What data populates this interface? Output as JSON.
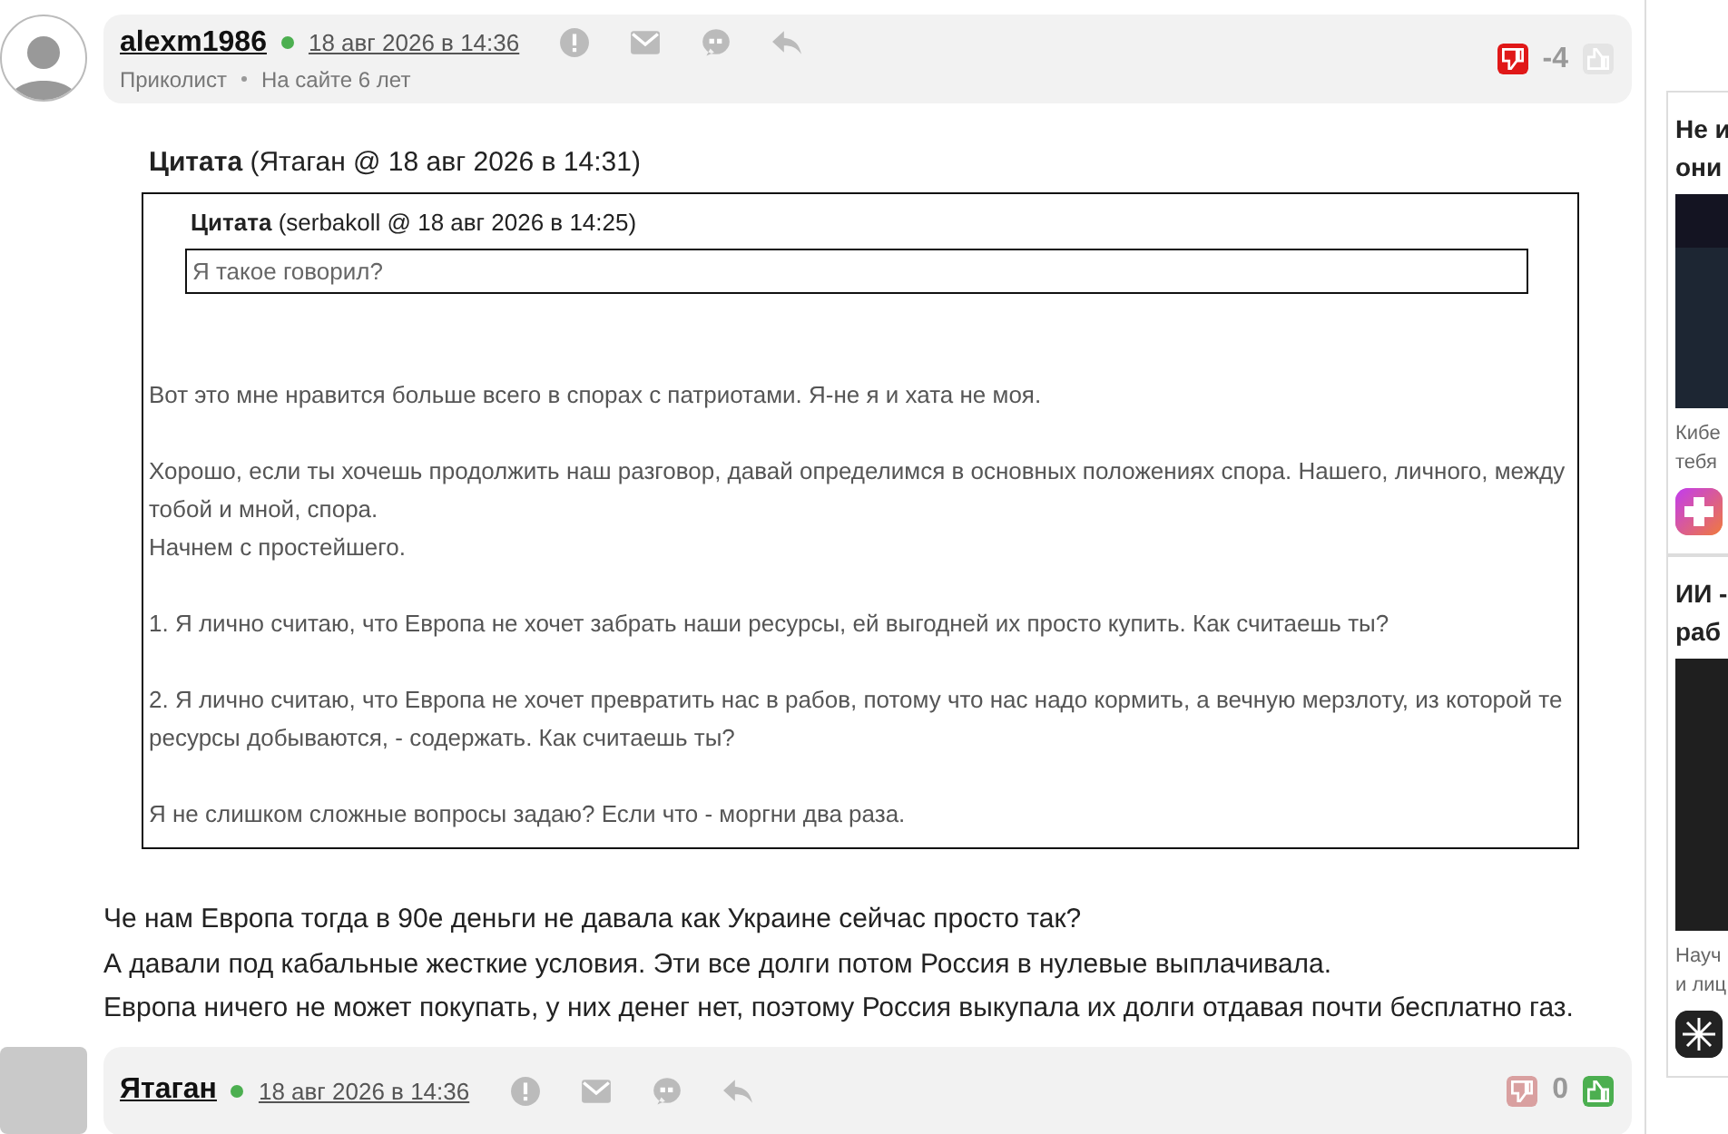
{
  "posts": [
    {
      "author": "alexm1986",
      "online": true,
      "date": "18 авг 2026 в 14:36",
      "subtitle": [
        "Приколист",
        "На сайте 6 лет"
      ],
      "rating": "-4",
      "downvote_active": true,
      "upvote_active": false,
      "quote": {
        "title": "Цитата",
        "source": "(Ятаган @ 18 авг 2026 в 14:31)",
        "inner": {
          "title": "Цитата",
          "source": "(serbakoll @ 18 авг 2026 в 14:25)",
          "text": "Я такое говорил?"
        },
        "paragraphs": [
          [
            "Вот это мне нравится больше всего в спорах с патриотами. Я-не я и хата не моя."
          ],
          [
            "Хорошо, если ты хочешь продолжить наш разговор, давай определимся в основных положениях спора. Нашего, личного, между тобой и мной, спора.",
            "Начнем с простейшего."
          ],
          [
            "1. Я лично считаю, что Европа не хочет забрать наши ресурсы, ей выгодней их просто купить. Как считаешь ты?"
          ],
          [
            "2. Я лично считаю, что Европа не хочет превратить нас в рабов, потому что нас надо кормить, а вечную мерзлоту, из которой те ресурсы добываются, - содержать. Как считаешь ты?"
          ],
          [
            "Я не слишком сложные вопросы задаю? Если что - моргни два раза."
          ]
        ]
      },
      "body": [
        "Че нам Европа тогда в 90е деньги не давала как Украине сейчас просто так?",
        "А давали под кабальные жесткие условия. Эти все долги потом Россия в нулевые выплачивала.",
        "Европа ничего не может покупать, у них денег нет, поэтому Россия выкупала их долги отдавая почти бесплатно газ."
      ]
    },
    {
      "author": "Ятаган",
      "online": true,
      "date": "18 авг 2026 в 14:36",
      "rating": "0",
      "downvote_active": false,
      "upvote_active": true
    }
  ],
  "sidebar": {
    "ads": [
      {
        "title": [
          "Не и",
          "они"
        ],
        "description": [
          "Кибе",
          "тебя"
        ]
      },
      {
        "title": [
          "ИИ -",
          "раб"
        ],
        "description": [
          "Науч",
          "и лиц"
        ]
      }
    ]
  }
}
